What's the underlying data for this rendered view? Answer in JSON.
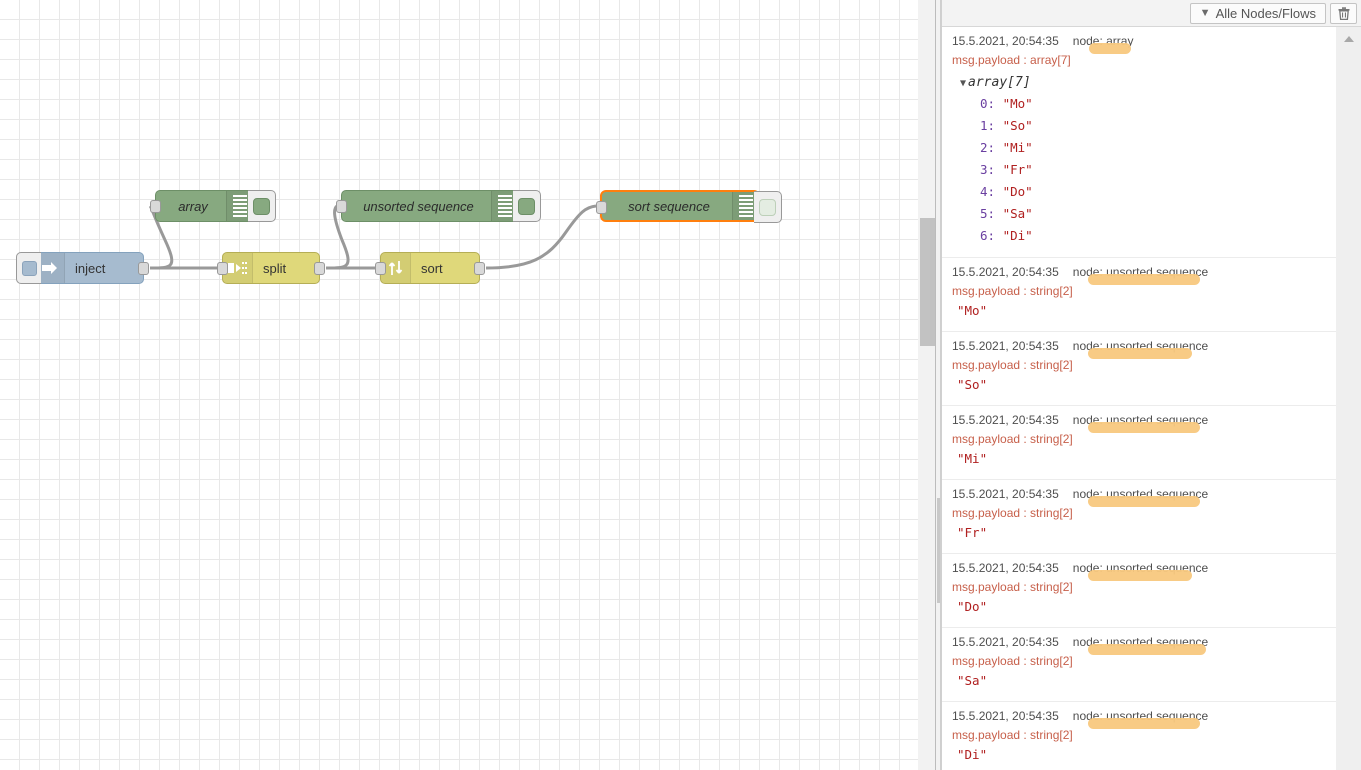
{
  "canvas": {
    "nodes": [
      {
        "id": "inject",
        "type": "inject",
        "label": "inject",
        "icon": "arrow-right-icon"
      },
      {
        "id": "split",
        "type": "split",
        "label": "split",
        "icon": "split-icon"
      },
      {
        "id": "sort",
        "type": "sort",
        "label": "sort",
        "icon": "sort-updown-icon"
      },
      {
        "id": "array",
        "type": "debug",
        "label": "array",
        "icon": "debug-bars-icon",
        "enabled": true,
        "selected": false
      },
      {
        "id": "unsorted",
        "type": "debug",
        "label": "unsorted sequence",
        "icon": "debug-bars-icon",
        "enabled": true,
        "selected": false
      },
      {
        "id": "sortseq",
        "type": "debug",
        "label": "sort sequence",
        "icon": "debug-bars-icon",
        "enabled": false,
        "selected": true
      }
    ],
    "selection_color": "#ff7f0e"
  },
  "sidebar": {
    "toolbar": {
      "filter_label": "Alle Nodes/Flows",
      "filter_icon": "funnel-icon",
      "clear_icon": "trash-icon"
    },
    "scrollbar": {
      "up_arrow_icon": "scroll-up-arrow-icon"
    },
    "messages": [
      {
        "timestamp": "15.5.2021, 20:54:35",
        "node_prefix": "node:",
        "node_name": "array",
        "property": "msg.payload :",
        "type": "array[7]",
        "expanded_root": "array[7]",
        "items": [
          {
            "index": "0:",
            "value": "\"Mo\""
          },
          {
            "index": "1:",
            "value": "\"So\""
          },
          {
            "index": "2:",
            "value": "\"Mi\""
          },
          {
            "index": "3:",
            "value": "\"Fr\""
          },
          {
            "index": "4:",
            "value": "\"Do\""
          },
          {
            "index": "5:",
            "value": "\"Sa\""
          },
          {
            "index": "6:",
            "value": "\"Di\""
          }
        ],
        "highlight_width": 42
      },
      {
        "timestamp": "15.5.2021, 20:54:35",
        "node_prefix": "node:",
        "node_name": "unsorted sequence",
        "property": "msg.payload :",
        "type": "string[2]",
        "value": "\"Mo\"",
        "highlight_width": 112
      },
      {
        "timestamp": "15.5.2021, 20:54:35",
        "node_prefix": "node:",
        "node_name": "unsorted sequence",
        "property": "msg.payload :",
        "type": "string[2]",
        "value": "\"So\"",
        "highlight_width": 104
      },
      {
        "timestamp": "15.5.2021, 20:54:35",
        "node_prefix": "node:",
        "node_name": "unsorted sequence",
        "property": "msg.payload :",
        "type": "string[2]",
        "value": "\"Mi\"",
        "highlight_width": 112
      },
      {
        "timestamp": "15.5.2021, 20:54:35",
        "node_prefix": "node:",
        "node_name": "unsorted sequence",
        "property": "msg.payload :",
        "type": "string[2]",
        "value": "\"Fr\"",
        "highlight_width": 112
      },
      {
        "timestamp": "15.5.2021, 20:54:35",
        "node_prefix": "node:",
        "node_name": "unsorted sequence",
        "property": "msg.payload :",
        "type": "string[2]",
        "value": "\"Do\"",
        "highlight_width": 104
      },
      {
        "timestamp": "15.5.2021, 20:54:35",
        "node_prefix": "node:",
        "node_name": "unsorted sequence",
        "property": "msg.payload :",
        "type": "string[2]",
        "value": "\"Sa\"",
        "highlight_width": 118
      },
      {
        "timestamp": "15.5.2021, 20:54:35",
        "node_prefix": "node:",
        "node_name": "unsorted sequence",
        "property": "msg.payload :",
        "type": "string[2]",
        "value": "\"Di\"",
        "highlight_width": 112
      }
    ]
  },
  "colors": {
    "inject": "#a6bbcf",
    "function_yellow": "#dfd87a",
    "debug_green": "#87a980",
    "highlight_orange": "#f8c87e",
    "selection_orange": "#ff7f0e"
  }
}
